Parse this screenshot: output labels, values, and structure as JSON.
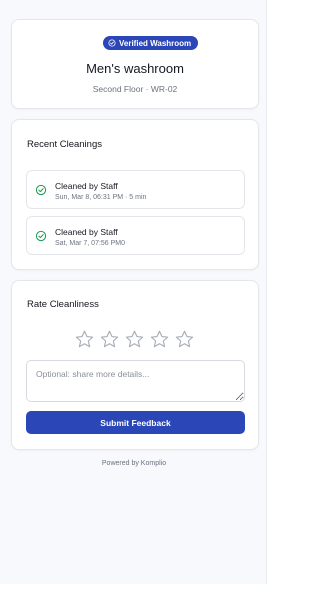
{
  "header": {
    "badge_label": "Verified Washroom",
    "badge_icon": "shield-check-icon",
    "title": "Men's washroom",
    "subtitle": "Second Floor · WR-02"
  },
  "cleanings": {
    "title": "Recent Cleanings",
    "items": [
      {
        "label": "Cleaned by Staff",
        "time": "Sun, Mar 8, 06:31 PM · 5 min",
        "icon": "check-circle-icon"
      },
      {
        "label": "Cleaned by Staff",
        "time": "Sat, Mar 7, 07:56 PM0",
        "icon": "check-circle-icon"
      }
    ]
  },
  "rating": {
    "title": "Rate Cleanliness",
    "stars_total": 5,
    "stars_selected": 0,
    "placeholder": "Optional: share more details...",
    "value": "",
    "submit_label": "Submit Feedback"
  },
  "footer": {
    "text": "Powered by Komplio"
  },
  "colors": {
    "accent": "#2b46b6",
    "success": "#1f9d55",
    "background": "#f8f9fc",
    "star_outline": "#a7adb7"
  }
}
